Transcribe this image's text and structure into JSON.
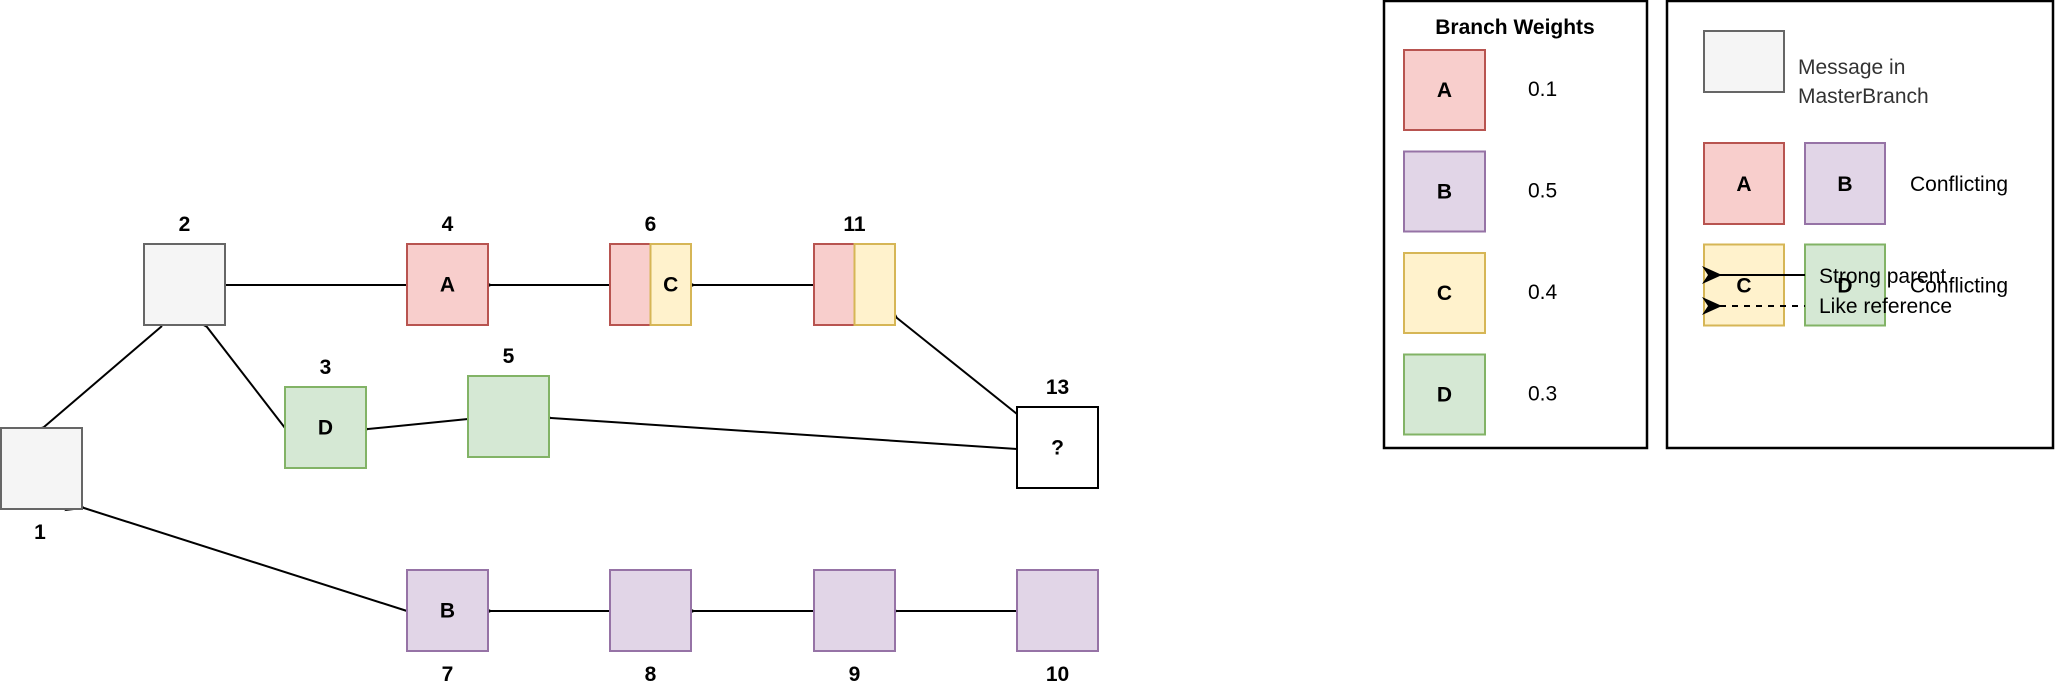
{
  "colors": {
    "master": {
      "fill": "#f5f5f5",
      "stroke": "#666666"
    },
    "A": {
      "fill": "#f8cecc",
      "stroke": "#b85450"
    },
    "B": {
      "fill": "#e1d5e7",
      "stroke": "#9673a6"
    },
    "C": {
      "fill": "#fff2cc",
      "stroke": "#d6b656"
    },
    "D": {
      "fill": "#d5e8d4",
      "stroke": "#82b366"
    },
    "unknown": {
      "fill": "#ffffff",
      "stroke": "#000000"
    }
  },
  "nodes": [
    {
      "id": "1",
      "label": "1",
      "text": "",
      "branches": [
        "master"
      ]
    },
    {
      "id": "2",
      "label": "2",
      "text": "",
      "branches": [
        "master"
      ]
    },
    {
      "id": "3",
      "label": "3",
      "text": "D",
      "branches": [
        "D"
      ]
    },
    {
      "id": "4",
      "label": "4",
      "text": "A",
      "branches": [
        "A"
      ]
    },
    {
      "id": "5",
      "label": "5",
      "text": "",
      "branches": [
        "D"
      ]
    },
    {
      "id": "6",
      "label": "6",
      "text": "C",
      "branches": [
        "A",
        "C"
      ]
    },
    {
      "id": "7",
      "label": "7",
      "text": "B",
      "branches": [
        "B"
      ]
    },
    {
      "id": "8",
      "label": "8",
      "text": "",
      "branches": [
        "B"
      ]
    },
    {
      "id": "9",
      "label": "9",
      "text": "",
      "branches": [
        "B"
      ]
    },
    {
      "id": "10",
      "label": "10",
      "text": "",
      "branches": [
        "B"
      ]
    },
    {
      "id": "11",
      "label": "11",
      "text": "",
      "branches": [
        "A",
        "C"
      ]
    },
    {
      "id": "13",
      "label": "13",
      "text": "?",
      "branches": [
        "unknown"
      ]
    }
  ],
  "edges": [
    {
      "from": "2",
      "to": "1",
      "type": "strong"
    },
    {
      "from": "3",
      "to": "2",
      "type": "strong"
    },
    {
      "from": "4",
      "to": "2",
      "type": "strong"
    },
    {
      "from": "5",
      "to": "3",
      "type": "strong"
    },
    {
      "from": "6",
      "to": "4",
      "type": "strong"
    },
    {
      "from": "11",
      "to": "6",
      "type": "strong"
    },
    {
      "from": "13",
      "to": "11",
      "type": "strong"
    },
    {
      "from": "13",
      "to": "5",
      "type": "strong"
    },
    {
      "from": "7",
      "to": "1",
      "type": "strong"
    },
    {
      "from": "8",
      "to": "7",
      "type": "strong"
    },
    {
      "from": "9",
      "to": "8",
      "type": "strong"
    },
    {
      "from": "10",
      "to": "9",
      "type": "strong"
    }
  ],
  "branch_weights": {
    "title": "Branch Weights",
    "items": [
      {
        "branch": "A",
        "label": "A",
        "weight": "0.1"
      },
      {
        "branch": "B",
        "label": "B",
        "weight": "0.5"
      },
      {
        "branch": "C",
        "label": "C",
        "weight": "0.4"
      },
      {
        "branch": "D",
        "label": "D",
        "weight": "0.3"
      }
    ]
  },
  "legend": {
    "master_line1": "Message in",
    "master_line2": "MasterBranch",
    "conflicts": [
      {
        "left": "A",
        "right": "B",
        "text": "Conflicting"
      },
      {
        "left": "C",
        "right": "D",
        "text": "Conflicting"
      }
    ],
    "strong_parent": "Strong parent",
    "like_reference": "Like reference"
  }
}
